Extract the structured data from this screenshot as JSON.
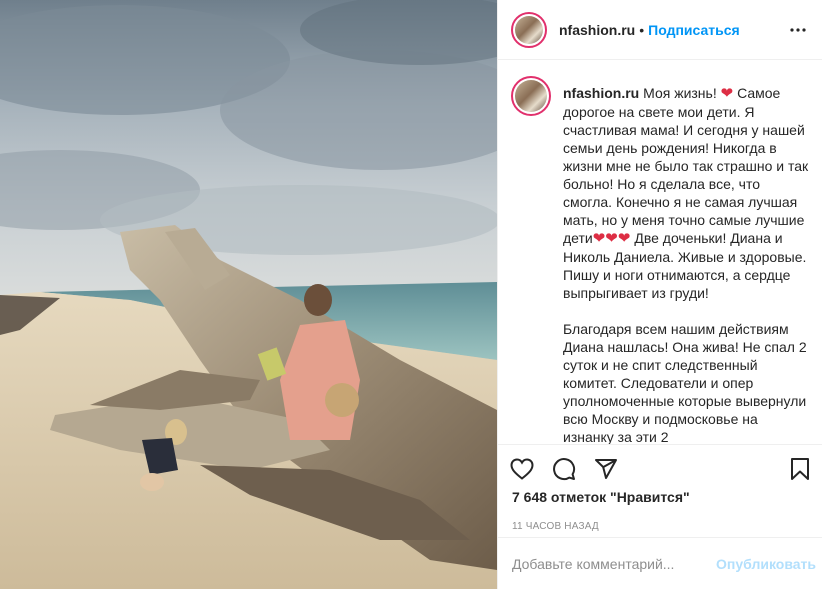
{
  "header": {
    "username": "nfashion.ru",
    "separator": "•",
    "follow_label": "Подписаться",
    "more_icon": "more-horizontal-icon"
  },
  "caption": {
    "username": "nfashion.ru",
    "p1_a": " Моя жизнь! ",
    "heart": "❤",
    "p1_b": " Самое дорогое на свете мои дети. Я счастливая мама! И сегодня у нашей семьи день рождения! Никогда в жизни мне не было так страшно и так больно! Но я сделала все, что смогла. Конечно я не самая лучшая мать, но у меня точно самые лучшие дети",
    "hearts": "❤❤❤",
    "p1_c": " Две доченьки! Диана и Николь Даниела. Живые и здоровые. Пишу и ноги отнимаются, а сердце выпрыгивает из груди!",
    "p2": "Благодаря всем нашим действиям Диана нашлась! Она жива! Не спал 2 суток и не спит следственный комитет. Следователи и опер уполномоченные которые вывернули всю Москву и подмосковье на изнанку за эти 2"
  },
  "actions": {
    "like_icon": "heart-icon",
    "comment_icon": "comment-icon",
    "share_icon": "share-icon",
    "save_icon": "bookmark-icon"
  },
  "likes": "7 648 отметок \"Нравится\"",
  "time": "11 часов назад",
  "comment": {
    "placeholder": "Добавьте комментарий...",
    "publish_label": "Опубликовать"
  },
  "colors": {
    "accent": "#0095f6",
    "publish_disabled": "#b2dffc",
    "heart": "#dd2e44",
    "border": "#efefef"
  }
}
